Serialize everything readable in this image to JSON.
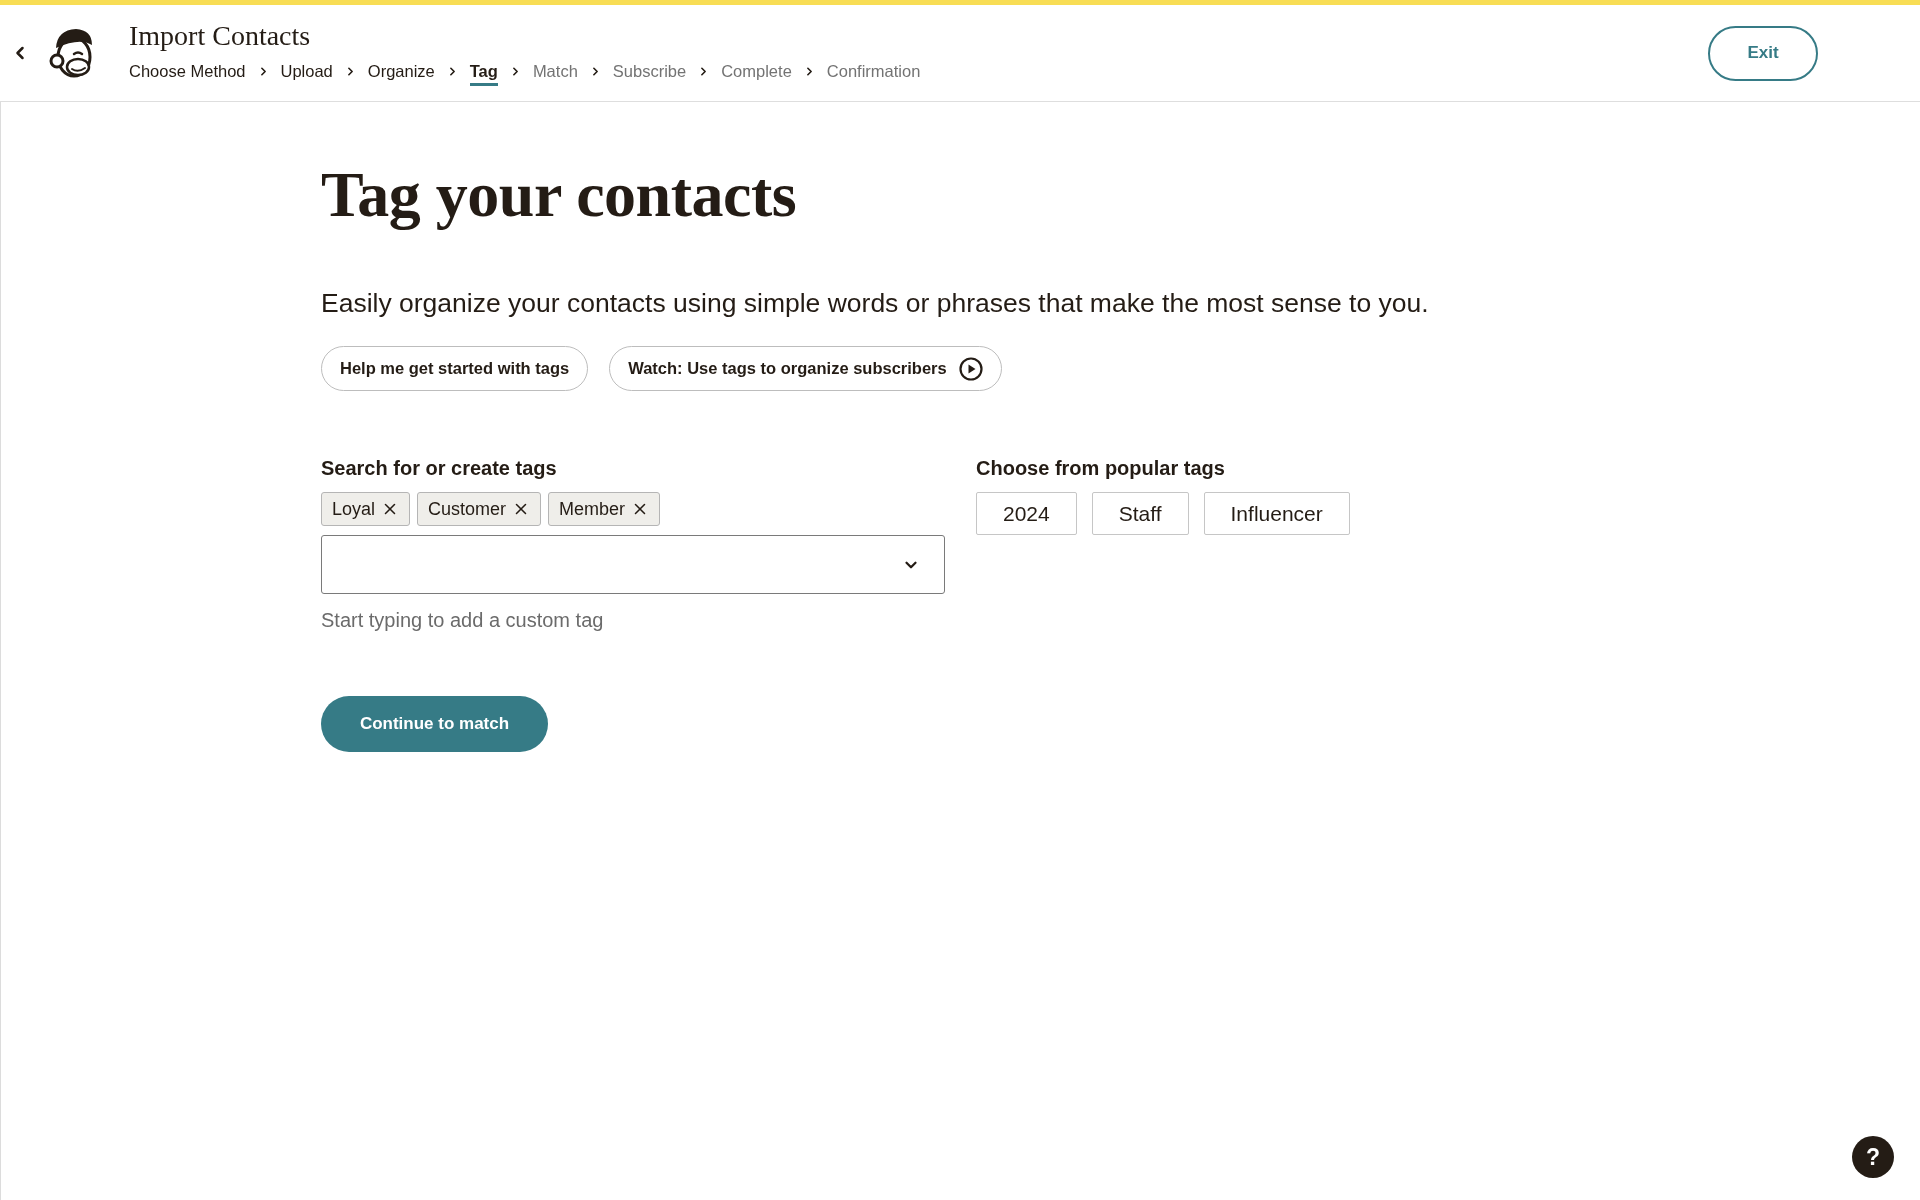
{
  "header": {
    "title": "Import Contacts",
    "steps": [
      {
        "label": "Choose Method",
        "selected": false,
        "disabled": false
      },
      {
        "label": "Upload",
        "selected": false,
        "disabled": false
      },
      {
        "label": "Organize",
        "selected": false,
        "disabled": false
      },
      {
        "label": "Tag",
        "selected": true,
        "disabled": false
      },
      {
        "label": "Match",
        "selected": false,
        "disabled": true
      },
      {
        "label": "Subscribe",
        "selected": false,
        "disabled": true
      },
      {
        "label": "Complete",
        "selected": false,
        "disabled": true
      },
      {
        "label": "Confirmation",
        "selected": false,
        "disabled": true
      }
    ],
    "exit_button": "Exit"
  },
  "page": {
    "heading": "Tag your contacts",
    "intro": "Easily organize your contacts using simple words or phrases that make the most sense to you.",
    "help_buttons": [
      {
        "label": "Help me get started with tags",
        "kind": "link"
      },
      {
        "label": "Watch: Use tags to organize subscribers",
        "kind": "video"
      }
    ]
  },
  "tag_search": {
    "label": "Search for or create tags",
    "selected_tags": [
      "Loyal",
      "Customer",
      "Member"
    ],
    "help_text": "Start typing to add a custom tag"
  },
  "popular_tags": {
    "label": "Choose from popular tags",
    "tags": [
      "2024",
      "Staff",
      "Influencer"
    ]
  },
  "continue_button": "Continue to match",
  "help_fab": "?"
}
